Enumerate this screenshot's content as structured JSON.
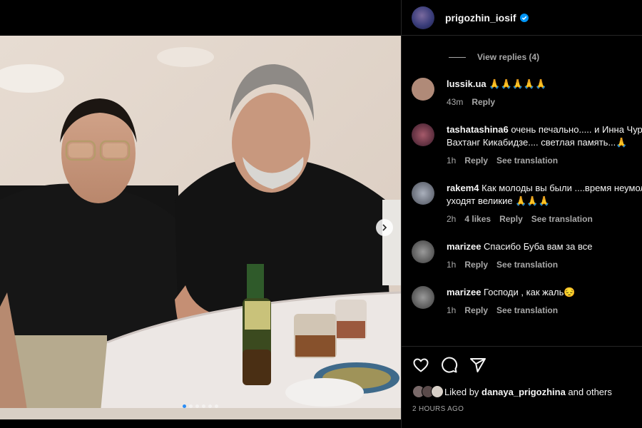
{
  "post": {
    "username": "prigozhin_iosif",
    "verified": true,
    "timestamp": "2 HOURS AGO",
    "liked_by_user": "danaya_prigozhina",
    "liked_by_prefix": "Liked by",
    "liked_by_suffix": "and others",
    "carousel_total": 6,
    "carousel_active": 1
  },
  "comments": {
    "view_replies": "View replies (4)",
    "items": [
      {
        "user": "lussik.ua",
        "text": "🙏🙏🙏🙏🙏",
        "time": "43m",
        "likes": "",
        "reply": "Reply",
        "translation": "",
        "avatar_color": "#b08a78"
      },
      {
        "user": "tashatashina6",
        "text": "очень печально..... и Инна Чурикова и",
        "text2": "Вахтанг Кикабидзе.... светлая память...🙏",
        "time": "1h",
        "likes": "",
        "reply": "Reply",
        "translation": "See translation",
        "avatar_color": "#7a3a4a"
      },
      {
        "user": "rakem4",
        "text": "Как молоды вы были ....время неумолимо",
        "text2": "уходят великие 🙏🙏🙏",
        "time": "2h",
        "likes": "4 likes",
        "reply": "Reply",
        "translation": "See translation",
        "avatar_color": "#8a8f9a"
      },
      {
        "user": "marizee",
        "text": "Спасибо Буба вам за все",
        "time": "1h",
        "likes": "",
        "reply": "Reply",
        "translation": "See translation",
        "avatar_color": "#6a6a6a"
      },
      {
        "user": "marizee",
        "text": "Господи , как жаль😔",
        "time": "1h",
        "likes": "",
        "reply": "Reply",
        "translation": "See translation",
        "avatar_color": "#6a6a6a"
      }
    ]
  },
  "icons": {
    "like": "heart-icon",
    "comment": "comment-icon",
    "share": "share-icon",
    "next": "chevron-right-icon",
    "load_more": "plus-circle-icon",
    "verified": "verified-badge-icon"
  },
  "colors": {
    "background": "#000000",
    "text": "#f5f5f5",
    "secondary_text": "#a8a8a8",
    "divider": "#262626",
    "verified_blue": "#0095f6"
  }
}
